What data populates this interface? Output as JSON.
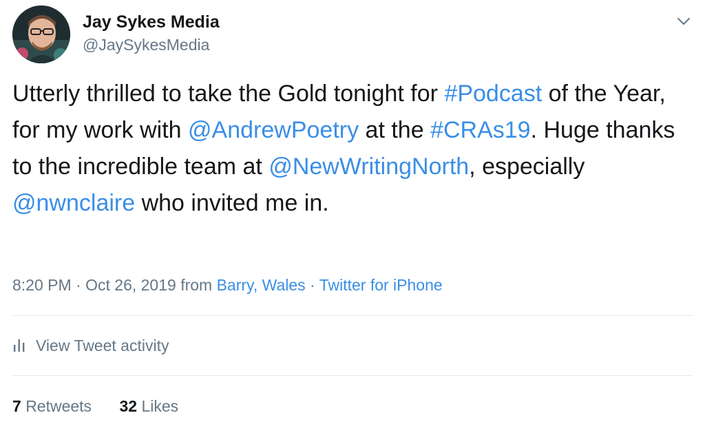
{
  "author": {
    "name": "Jay Sykes Media",
    "handle": "@JaySykesMedia"
  },
  "tweet": {
    "t1": "Utterly thrilled to take the Gold tonight for ",
    "l1": "#Podcast",
    "t2": " of the Year, for my work with ",
    "l2": "@AndrewPoetry",
    "t3": " at the ",
    "l3": "#CRAs19",
    "t4": ". Huge thanks to the incredible team at ",
    "l4": "@NewWritingNorth",
    "t5": ", especially ",
    "l5": "@nwnclaire",
    "t6": " who invited me in."
  },
  "meta": {
    "time": "8:20 PM",
    "sep1": " · ",
    "date": "Oct 26, 2019",
    "from": " from ",
    "location": "Barry, Wales",
    "sep2": " · ",
    "source": "Twitter for iPhone"
  },
  "activity": {
    "label": "View Tweet activity"
  },
  "stats": {
    "retweets_count": "7",
    "retweets_label": "Retweets",
    "likes_count": "32",
    "likes_label": "Likes"
  },
  "icons": {
    "caret": "chevron-down-icon",
    "analytics": "bar-chart-icon"
  },
  "colors": {
    "link": "#3a8ee6",
    "secondary_text": "#657786",
    "primary_text": "#14171a"
  }
}
